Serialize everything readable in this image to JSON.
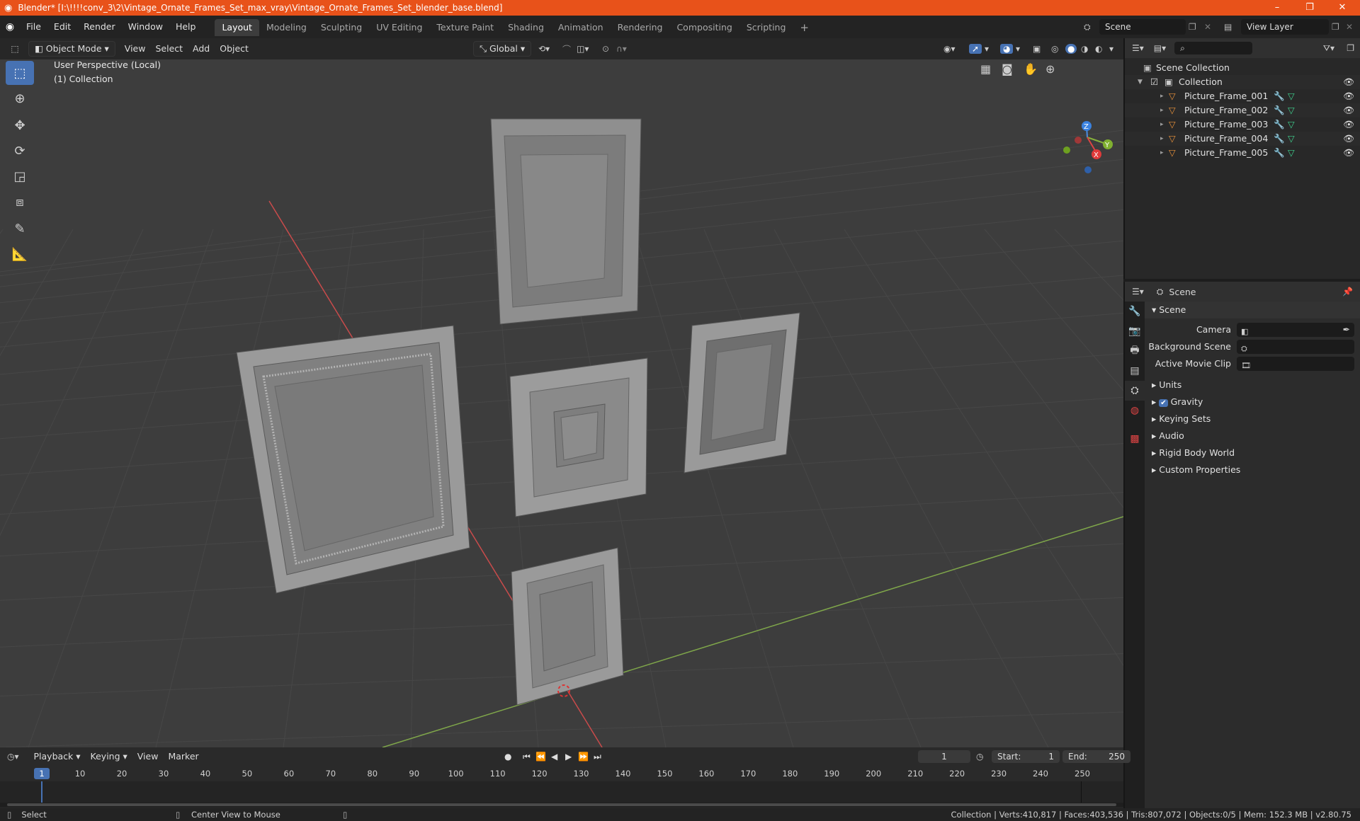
{
  "window": {
    "title": "Blender* [I:\\!!!!conv_3\\2\\Vintage_Ornate_Frames_Set_max_vray\\Vintage_Ornate_Frames_Set_blender_base.blend]",
    "controls": [
      "–",
      "❐",
      "✕"
    ]
  },
  "menus": [
    "File",
    "Edit",
    "Render",
    "Window",
    "Help"
  ],
  "workspaces": {
    "tabs": [
      "Layout",
      "Modeling",
      "Sculpting",
      "UV Editing",
      "Texture Paint",
      "Shading",
      "Animation",
      "Rendering",
      "Compositing",
      "Scripting"
    ],
    "active": "Layout",
    "add": "+"
  },
  "scene_selector": {
    "value": "Scene"
  },
  "view_layer_selector": {
    "value": "View Layer"
  },
  "viewport_header": {
    "mode": "Object Mode",
    "menus": [
      "View",
      "Select",
      "Add",
      "Object"
    ],
    "transform_orientation": "Global"
  },
  "viewport": {
    "perspective_label": "User Perspective (Local)",
    "collection_label": "(1) Collection",
    "gizmo_axes": {
      "z": "Z",
      "y": "Y",
      "x": "X"
    },
    "background_color": "#3d3d3d",
    "grid_color": "#474747",
    "x_axis_color": "#c94b4b",
    "y_axis_color": "#7fa64a"
  },
  "outliner": {
    "root": "Scene Collection",
    "collection": "Collection",
    "objects": [
      "Picture_Frame_001",
      "Picture_Frame_002",
      "Picture_Frame_003",
      "Picture_Frame_004",
      "Picture_Frame_005"
    ]
  },
  "properties": {
    "header_title": "Scene",
    "panel_title": "Scene",
    "fields": [
      {
        "label": "Camera",
        "icon": "camera-icon"
      },
      {
        "label": "Background Scene",
        "icon": "scene-icon"
      },
      {
        "label": "Active Movie Clip",
        "icon": "clip-icon"
      }
    ],
    "sections": [
      "Units",
      "Gravity",
      "Keying Sets",
      "Audio",
      "Rigid Body World",
      "Custom Properties"
    ],
    "gravity_checked": true
  },
  "timeline": {
    "menus": [
      "Playback",
      "Keying",
      "View",
      "Marker"
    ],
    "current_frame": "1",
    "start_label": "Start:",
    "start": "1",
    "end_label": "End:",
    "end": "250",
    "ruler": [
      "10",
      "20",
      "30",
      "40",
      "50",
      "60",
      "70",
      "80",
      "90",
      "100",
      "110",
      "120",
      "130",
      "140",
      "150",
      "160",
      "170",
      "180",
      "190",
      "200",
      "210",
      "220",
      "230",
      "240",
      "250"
    ],
    "playhead": "1"
  },
  "status": {
    "select": "Select",
    "center": "Center View to Mouse",
    "stats": "Collection | Verts:410,817 | Faces:403,536 | Tris:807,072 | Objects:0/5 | Mem: 152.3 MB | v2.80.75"
  },
  "colors": {
    "titlebar": "#e8521a",
    "accent": "#4772b3",
    "object_icon": "#e8913a",
    "modifier_icon": "#6fa3e0",
    "mesh_icon": "#3fd08e"
  }
}
